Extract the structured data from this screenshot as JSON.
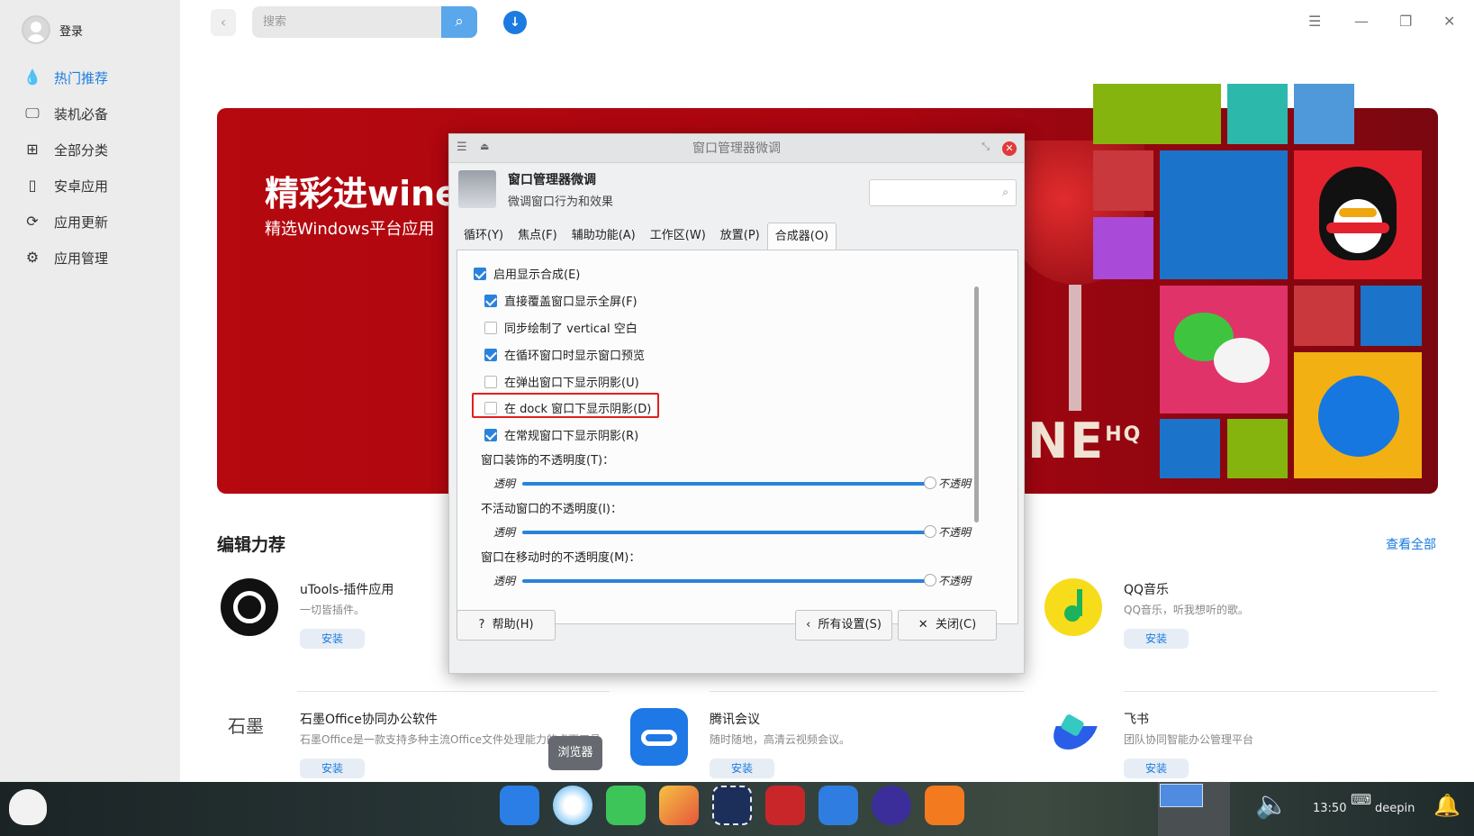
{
  "sidebar": {
    "user_label": "登录",
    "items": [
      {
        "label": "热门推荐",
        "icon": "flame-icon",
        "glyph": "💧",
        "active": true
      },
      {
        "label": "装机必备",
        "icon": "monitor-icon",
        "glyph": "🖵",
        "active": false
      },
      {
        "label": "全部分类",
        "icon": "grid-icon",
        "glyph": "⊞",
        "active": false
      },
      {
        "label": "安卓应用",
        "icon": "phone-icon",
        "glyph": "▯",
        "active": false
      },
      {
        "label": "应用更新",
        "icon": "refresh-icon",
        "glyph": "⟳",
        "active": false
      },
      {
        "label": "应用管理",
        "icon": "settings-icon",
        "glyph": "⚙",
        "active": false
      }
    ]
  },
  "topbar": {
    "search_placeholder": "搜索"
  },
  "banner": {
    "title": "精彩进wine",
    "subtitle": "精选Windows平台应用",
    "wine_logo": "INE",
    "wine_logo_sup": "HQ"
  },
  "section": {
    "title": "编辑力荐",
    "see_all": "查看全部"
  },
  "apps": [
    {
      "name": "uTools-插件应用",
      "desc": "一切皆插件。",
      "install": "安装"
    },
    {
      "name": "QQ音乐",
      "desc": "QQ音乐，听我想听的歌。",
      "install": "安装"
    },
    {
      "name": "石墨Office协同办公软件",
      "desc": "石墨Office是一款支持多种主流Office文件处理能力的桌面工具",
      "install": "安装",
      "icon_text": "石墨"
    },
    {
      "name": "腾讯会议",
      "desc": "随时随地，高清云视频会议。",
      "install": "安装"
    },
    {
      "name": "飞书",
      "desc": "团队协同智能办公管理平台",
      "install": "安装"
    }
  ],
  "tooltip": "浏览器",
  "dialog": {
    "window_title": "窗口管理器微调",
    "heading": "窗口管理器微调",
    "subheading": "微调窗口行为和效果",
    "tabs": [
      "循环(Y)",
      "焦点(F)",
      "辅助功能(A)",
      "工作区(W)",
      "放置(P)",
      "合成器(O)"
    ],
    "active_tab": "合成器(O)",
    "checkboxes": [
      {
        "label": "启用显示合成(E)",
        "checked": true
      },
      {
        "label": "直接覆盖窗口显示全屏(F)",
        "checked": true
      },
      {
        "label": "同步绘制了 vertical 空白",
        "checked": false
      },
      {
        "label": "在循环窗口时显示窗口预览",
        "checked": true
      },
      {
        "label": "在弹出窗口下显示阴影(U)",
        "checked": false
      },
      {
        "label": "在 dock 窗口下显示阴影(D)",
        "checked": false
      },
      {
        "label": "在常规窗口下显示阴影(R)",
        "checked": true
      }
    ],
    "sliders": [
      {
        "label": "窗口装饰的不透明度(T)：",
        "left": "透明",
        "right": "不透明",
        "value": 1.0
      },
      {
        "label": "不活动窗口的不透明度(I)：",
        "left": "透明",
        "right": "不透明",
        "value": 1.0
      },
      {
        "label": "窗口在移动时的不透明度(M)：",
        "left": "透明",
        "right": "不透明",
        "value": 1.0
      }
    ],
    "buttons": {
      "help": "帮助(H)",
      "all_settings": "所有设置(S)",
      "close": "关闭(C)"
    }
  },
  "taskbar": {
    "time": "13:50",
    "user": "deepin"
  },
  "colors": {
    "accent": "#1b7be0",
    "banner_red": "#b5080f",
    "checkbox_blue": "#2a82da",
    "highlight_red": "#e02020"
  }
}
